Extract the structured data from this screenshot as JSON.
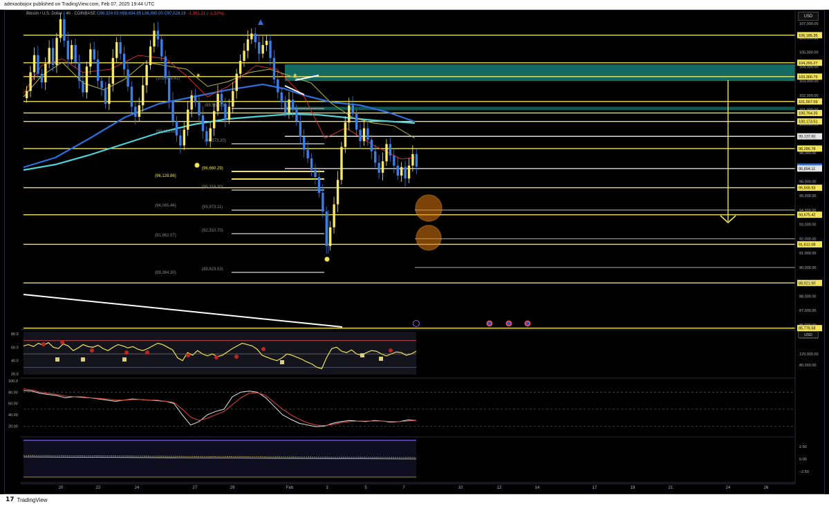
{
  "header": {
    "publisher_text": "adexaobojox published on TradingView.com, Feb 07, 2025 19:44 UTC"
  },
  "legend": {
    "symbol": "Bitcoin / U.S. Dollar · 4h · COINBASE",
    "open": "O98,324.03",
    "high": "H98,634.95",
    "low": "L96,890.00",
    "close": "C97,028.19",
    "change": "−1,301.21 (−1.32%)"
  },
  "currency_button": "USD",
  "currency_button_lower": "USD",
  "price_axis": {
    "ticks": [
      "107,000.00",
      "106,000.00",
      "105,000.00",
      "104,000.00",
      "103,000.00",
      "102,000.00",
      "101,000.00",
      "100,000.00",
      "99,000.00",
      "98,000.00",
      "97,000.00",
      "96,000.00",
      "95,000.00",
      "94,000.00",
      "93,000.00",
      "92,000.00",
      "91,000.00",
      "90,000.00",
      "89,000.00",
      "88,000.00",
      "87,000.00",
      "86,000.00"
    ],
    "level_labels": [
      {
        "text": "106,186.35",
        "kind": "yellow"
      },
      {
        "text": "104,265.27",
        "kind": "yellow"
      },
      {
        "text": "103,300.79",
        "kind": "yellow"
      },
      {
        "text": "101,567.59",
        "kind": "yellow"
      },
      {
        "text": "100,764.35",
        "kind": "yellow"
      },
      {
        "text": "100,173.51",
        "kind": "yellow"
      },
      {
        "text": "99,137.60",
        "kind": "white"
      },
      {
        "text": "98,286.78",
        "kind": "yellow"
      },
      {
        "text": "97,028.19",
        "kind": "blue"
      },
      {
        "text": "96,894.11",
        "kind": "white"
      },
      {
        "text": "95,555.93",
        "kind": "yellow"
      },
      {
        "text": "93,675.42",
        "kind": "yellow"
      },
      {
        "text": "91,612.08",
        "kind": "yellow"
      },
      {
        "text": "88,921.90",
        "kind": "yellow"
      },
      {
        "text": "85,776.58",
        "kind": "yellow"
      }
    ]
  },
  "fib_labels": [
    {
      "text": "(102,019.41)"
    },
    {
      "text": "(99,553.68)"
    },
    {
      "text": "(99,893.05)"
    },
    {
      "text": "(98,573.20)"
    },
    {
      "text": "(96,660.29)"
    },
    {
      "text": "(96,128.86)"
    },
    {
      "text": "(95,316.30)"
    },
    {
      "text": "(94,045.46)"
    },
    {
      "text": "(93,973.11)"
    },
    {
      "text": "(92,310.70)"
    },
    {
      "text": "(91,962.07)"
    },
    {
      "text": "(89,623.53)"
    },
    {
      "text": "(89,384.30)"
    }
  ],
  "indicator1_axis": {
    "left_ticks": [
      "80.0",
      "60.0",
      "40.0",
      "20.0"
    ],
    "right_ticks": [
      "160,000.00",
      "120,000.00",
      "80,000.00"
    ]
  },
  "indicator2_axis": {
    "left_ticks": [
      "100.0",
      "80.00",
      "60.00",
      "40.00",
      "20.00"
    ]
  },
  "indicator3_axis": {
    "right_ticks": [
      "2.50",
      "0.00",
      "−2.50"
    ]
  },
  "time_axis": {
    "labels": [
      "20",
      "22",
      "24",
      "27",
      "29",
      "Feb",
      "3",
      "5",
      "7",
      "10",
      "12",
      "14",
      "17",
      "19",
      "21",
      "24",
      "26"
    ]
  },
  "footer": {
    "brand": "TradingView"
  },
  "colors": {
    "up": "#f7e86b",
    "down": "#3a7ee6",
    "level": "#f2e35a",
    "zone": "#1b8f86",
    "ema_blue": "#2f6fe0",
    "ema_cyan": "#4fd1d9"
  }
}
